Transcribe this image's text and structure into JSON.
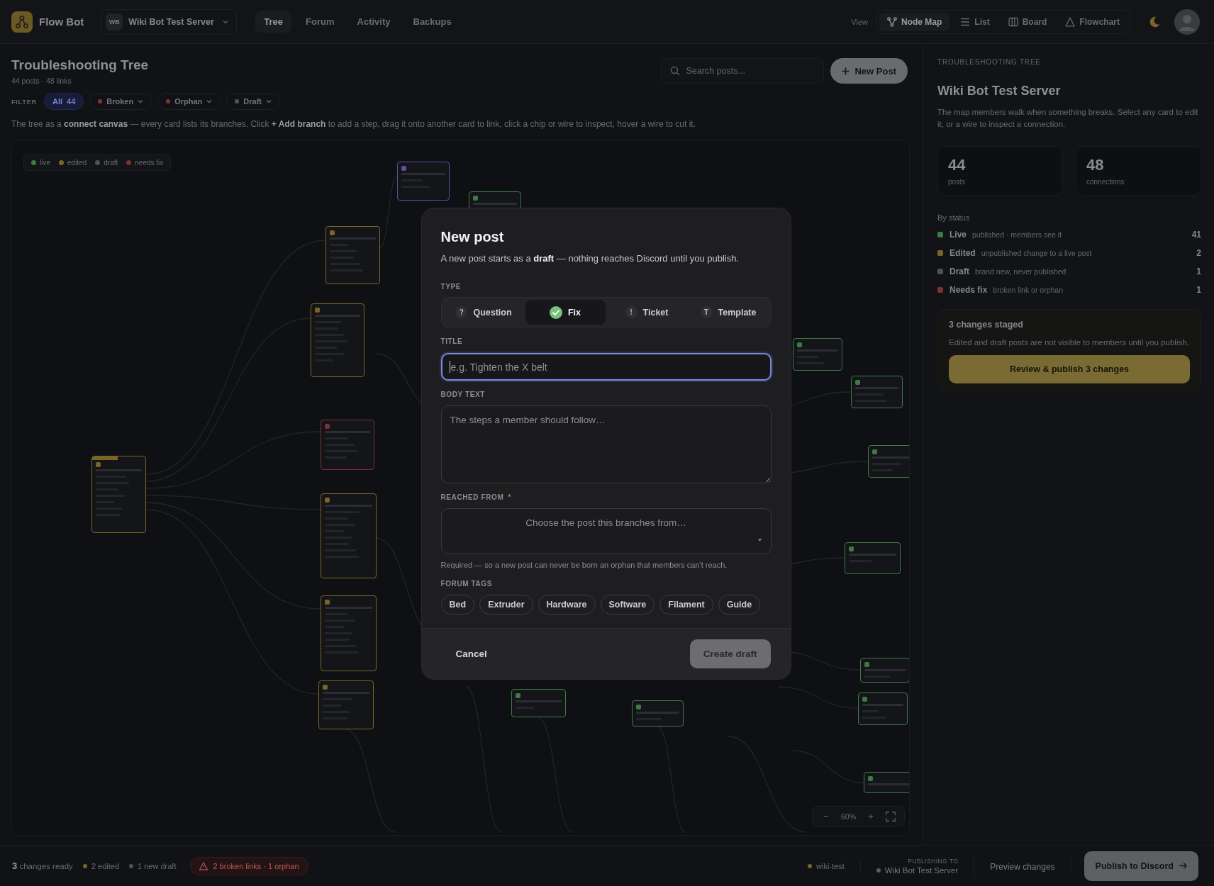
{
  "header": {
    "app_name": "Flow Bot",
    "server": {
      "initials": "WB",
      "name": "Wiki Bot Test Server"
    },
    "nav_tabs": [
      {
        "label": "Tree",
        "selected": true
      },
      {
        "label": "Forum",
        "selected": false
      },
      {
        "label": "Activity",
        "selected": false
      },
      {
        "label": "Backups",
        "selected": false
      }
    ],
    "view_label": "View",
    "views": [
      {
        "label": "Node Map",
        "selected": true
      },
      {
        "label": "List",
        "selected": false
      },
      {
        "label": "Board",
        "selected": false
      },
      {
        "label": "Flowchart",
        "selected": false
      }
    ]
  },
  "page": {
    "title": "Troubleshooting Tree",
    "subtitle": "44 posts · 48 links",
    "search": {
      "placeholder": "Search posts..."
    },
    "new_post_button": "New Post",
    "filter_label": "FILTER",
    "filters": [
      {
        "label": "All",
        "count": "44",
        "selected": true
      },
      {
        "label": "Broken",
        "color": "#7a3330",
        "has_menu": true,
        "selected": false
      },
      {
        "label": "Orphan",
        "color": "#7a3330",
        "has_menu": true,
        "selected": false
      },
      {
        "label": "Draft",
        "color": "#505155",
        "has_menu": true,
        "selected": false
      }
    ],
    "hint": "The tree as a **connect canvas** — every card lists its branches. Click **+ Add branch** to add a step, drag it onto another card to link, click a chip or wire to inspect, hover a wire to cut it."
  },
  "canvas": {
    "legend": [
      {
        "label": "live",
        "color": "#3d7a44"
      },
      {
        "label": "edited",
        "color": "#7a6526"
      },
      {
        "label": "draft",
        "color": "#505155"
      },
      {
        "label": "needs fix",
        "color": "#7a3330"
      }
    ],
    "nodes": [
      {
        "kind": "post",
        "color": "#5b4f9e"
      },
      {
        "kind": "post",
        "color": "#3d7a44"
      },
      {
        "kind": "post",
        "color": "#7a6526"
      },
      {
        "kind": "post",
        "color": "#7a6526"
      },
      {
        "kind": "post",
        "color": "#7a3330"
      },
      {
        "kind": "root",
        "color": "#7a6526"
      },
      {
        "kind": "post",
        "color": "#7a6526"
      },
      {
        "kind": "post",
        "color": "#7a6526"
      },
      {
        "kind": "post",
        "color": "#7a6526"
      },
      {
        "kind": "post",
        "color": "#3d7a44"
      },
      {
        "kind": "post",
        "color": "#3d7a44"
      },
      {
        "kind": "post",
        "color": "#3d7a44"
      },
      {
        "kind": "post",
        "color": "#3d7a44"
      },
      {
        "kind": "post",
        "color": "#3d7a44"
      },
      {
        "kind": "post",
        "color": "#3d7a44"
      },
      {
        "kind": "post",
        "color": "#3d7a44"
      },
      {
        "kind": "post",
        "color": "#3d7a44"
      },
      {
        "kind": "post",
        "color": "#3d7a44"
      }
    ],
    "zoom_out": "−",
    "zoom_level": "60%",
    "zoom_in": "+"
  },
  "panel": {
    "eyebrow": "TROUBLESHOOTING TREE",
    "title": "Wiki Bot Test Server",
    "description": "The map members walk when something breaks. Select any card to edit it, or a wire to inspect a connection.",
    "stats": [
      {
        "value": "44",
        "label": "posts"
      },
      {
        "value": "48",
        "label": "connections"
      }
    ],
    "status_heading": "By status",
    "statuses": [
      {
        "name": "Live",
        "note": "published · members see it",
        "count": "41",
        "color": "#3d7a44"
      },
      {
        "name": "Edited",
        "note": "unpublished change to a live post",
        "count": "2",
        "color": "#7a6526"
      },
      {
        "name": "Draft",
        "note": "brand new, never published",
        "count": "1",
        "color": "#505155"
      },
      {
        "name": "Needs fix",
        "note": "broken link or orphan",
        "count": "1",
        "color": "#7a3330"
      }
    ],
    "staged": {
      "title": "3 changes staged",
      "text": "Edited and draft posts are not visible to members until you publish.",
      "button": "Review & publish 3 changes"
    }
  },
  "status_bar": {
    "ready": "**3** changes ready",
    "items": [
      {
        "text": "2 edited",
        "color": "#7a6526"
      },
      {
        "text": "1 new draft",
        "color": "#505155"
      }
    ],
    "warning": "2 broken links · 1 orphan",
    "branch": {
      "text": "wiki-test",
      "color": "#7a6526"
    },
    "target_caption": "PUBLISHING TO",
    "target": {
      "text": "Wiki Bot Test Server",
      "color": "#5a5b60"
    },
    "preview_button": "Preview changes",
    "publish_button": "Publish to Discord"
  },
  "modal": {
    "title": "New post",
    "description": "A new post starts as a **draft** — nothing reaches Discord until you publish.",
    "type_label": "TYPE",
    "types": [
      {
        "label": "Question",
        "glyph": "?",
        "selected": false
      },
      {
        "label": "Fix",
        "selected": true
      },
      {
        "label": "Ticket",
        "glyph": "!",
        "selected": false
      },
      {
        "label": "Template",
        "glyph": "T",
        "selected": false
      }
    ],
    "title_field": {
      "label": "TITLE",
      "placeholder": "e.g. Tighten the X belt",
      "focused": true
    },
    "body_field": {
      "label": "BODY TEXT",
      "placeholder": "The steps a member should follow…"
    },
    "reached_from": {
      "label": "REACHED FROM",
      "required_mark": "*",
      "placeholder": "Choose the post this branches from…",
      "help": "Required — so a new post can never be born an orphan that members can't reach."
    },
    "tags_label": "FORUM TAGS",
    "tags": [
      {
        "label": "Bed",
        "selected": false
      },
      {
        "label": "Extruder",
        "selected": false
      },
      {
        "label": "Hardware",
        "selected": false
      },
      {
        "label": "Software",
        "selected": false
      },
      {
        "label": "Filament",
        "selected": false
      },
      {
        "label": "Guide",
        "selected": false
      }
    ],
    "cancel_button": "Cancel",
    "create_button": {
      "label": "Create draft",
      "disabled": true
    }
  }
}
